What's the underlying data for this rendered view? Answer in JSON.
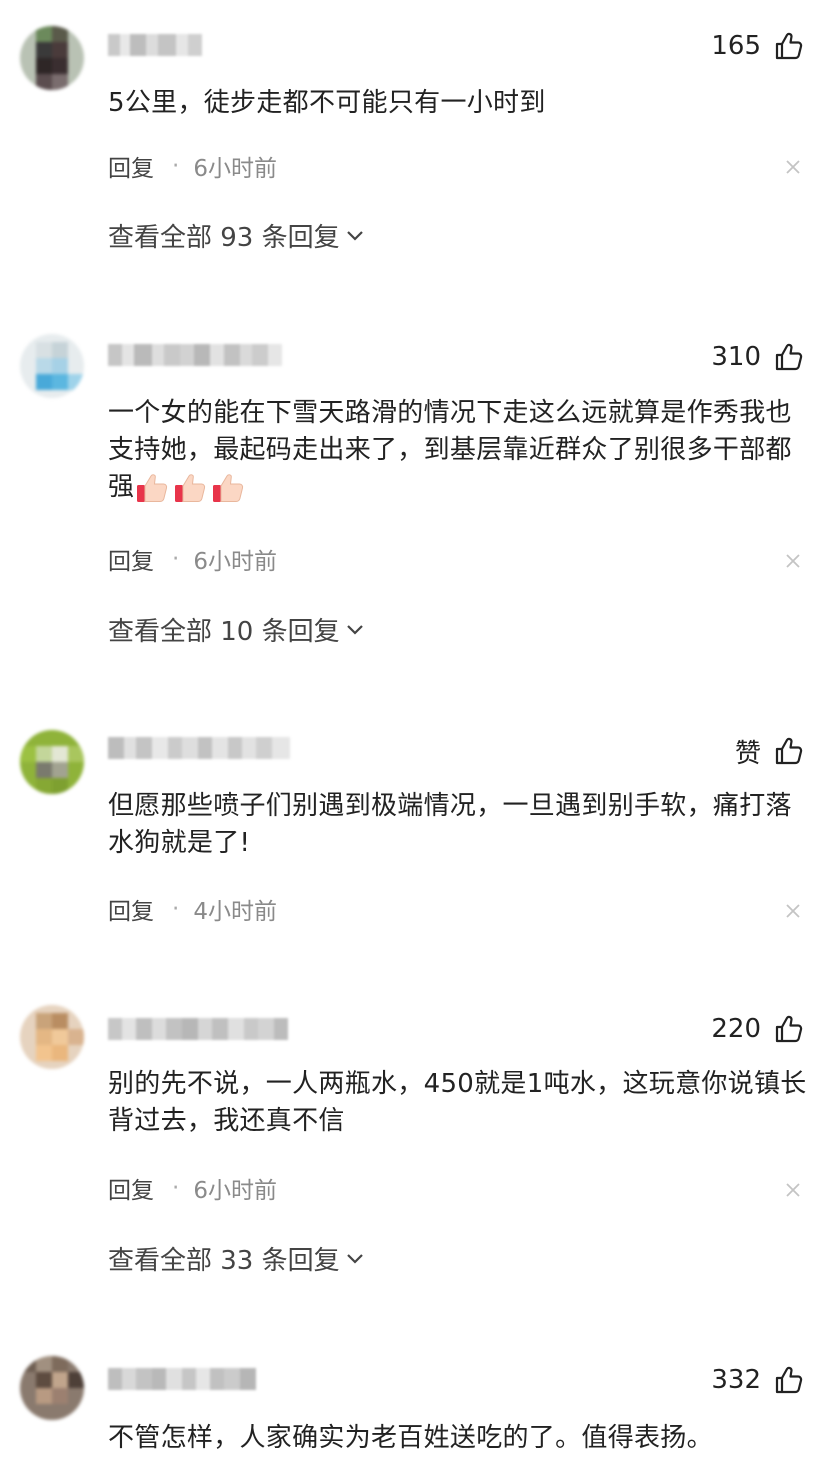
{
  "comments": [
    {
      "likes": "165",
      "text": "5公里，徒步走都不可能只有一小时到",
      "reply": "回复",
      "time": "6小时前",
      "view_replies": "查看全部 93 条回复"
    },
    {
      "likes": "310",
      "text": "一个女的能在下雪天路滑的情况下走这么远就算是作秀我也支持她，最起码走出来了，到基层靠近群众了别很多干部都强",
      "emoji": [
        "thumbs-up-emoji",
        "thumbs-up-emoji",
        "thumbs-up-emoji"
      ],
      "reply": "回复",
      "time": "6小时前",
      "view_replies": "查看全部 10 条回复"
    },
    {
      "likes": "赞",
      "text": "但愿那些喷子们别遇到极端情况，一旦遇到别手软，痛打落水狗就是了!",
      "reply": "回复",
      "time": "4小时前"
    },
    {
      "likes": "220",
      "text": "别的先不说，一人两瓶水，450就是1吨水，这玩意你说镇长背过去，我还真不信",
      "reply": "回复",
      "time": "6小时前",
      "view_replies": "查看全部 33 条回复"
    },
    {
      "likes": "332",
      "text": "不管怎样，人家确实为老百姓送吃的了。值得表扬。"
    }
  ],
  "icons": {
    "like": "thumbs-up-outline-icon",
    "close": "close-icon",
    "expand": "chevron-down-icon"
  },
  "colors": {
    "text": "#222222",
    "meta": "#8a8a8a",
    "link": "#444444",
    "background": "#ffffff"
  }
}
